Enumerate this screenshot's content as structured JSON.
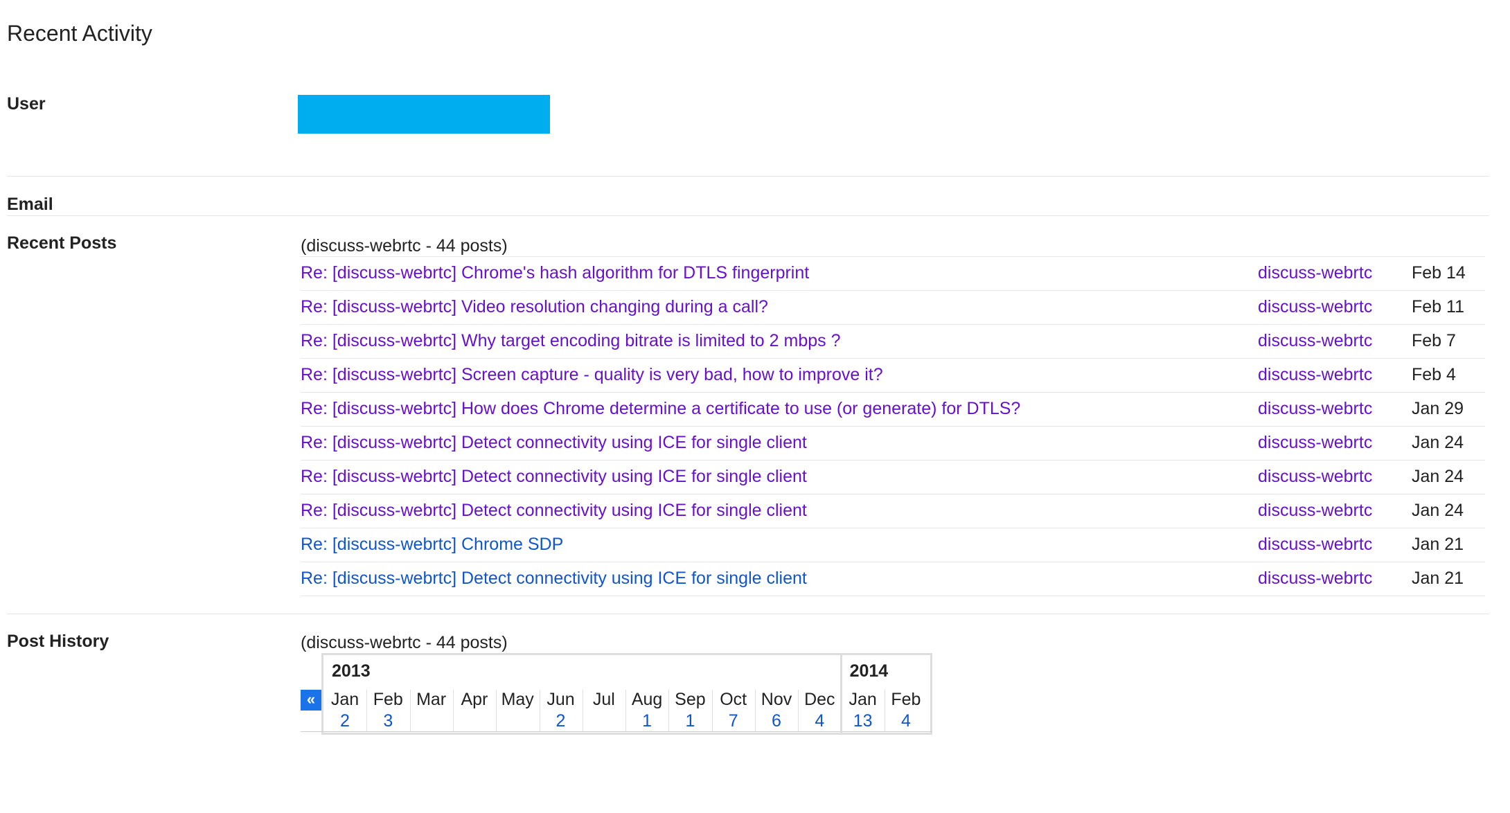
{
  "page": {
    "title": "Recent Activity"
  },
  "labels": {
    "user": "User",
    "email": "Email",
    "recent_posts": "Recent Posts",
    "post_history": "Post History"
  },
  "user_block_color": "#00aeef",
  "recent_posts": {
    "summary": "(discuss-webrtc - 44 posts)",
    "rows": [
      {
        "title": "Re: [discuss-webrtc] Chrome's hash algorithm for DTLS fingerprint",
        "group": "discuss-webrtc",
        "date": "Feb 14"
      },
      {
        "title": "Re: [discuss-webrtc] Video resolution changing during a call?",
        "group": "discuss-webrtc",
        "date": "Feb 11"
      },
      {
        "title": "Re: [discuss-webrtc] Why target encoding bitrate is limited to 2 mbps ?",
        "group": "discuss-webrtc",
        "date": "Feb 7"
      },
      {
        "title": "Re: [discuss-webrtc] Screen capture - quality is very bad, how to improve it?",
        "group": "discuss-webrtc",
        "date": "Feb 4"
      },
      {
        "title": "Re: [discuss-webrtc] How does Chrome determine a certificate to use (or generate) for DTLS?",
        "group": "discuss-webrtc",
        "date": "Jan 29"
      },
      {
        "title": "Re: [discuss-webrtc] Detect connectivity using ICE for single client",
        "group": "discuss-webrtc",
        "date": "Jan 24"
      },
      {
        "title": "Re: [discuss-webrtc] Detect connectivity using ICE for single client",
        "group": "discuss-webrtc",
        "date": "Jan 24"
      },
      {
        "title": "Re: [discuss-webrtc] Detect connectivity using ICE for single client",
        "group": "discuss-webrtc",
        "date": "Jan 24"
      },
      {
        "title": "Re: [discuss-webrtc] Chrome SDP",
        "group": "discuss-webrtc",
        "date": "Jan 21"
      },
      {
        "title": "Re: [discuss-webrtc] Detect connectivity using ICE for single client",
        "group": "discuss-webrtc",
        "date": "Jan 21"
      }
    ]
  },
  "post_history": {
    "summary": "(discuss-webrtc - 44 posts)",
    "prev_icon": "double-chevron-left-icon",
    "prev_glyph": "«",
    "years": [
      "2013",
      "2014"
    ],
    "months": [
      {
        "year": "2013",
        "month": "Jan",
        "count": "2"
      },
      {
        "year": "2013",
        "month": "Feb",
        "count": "3"
      },
      {
        "year": "2013",
        "month": "Mar",
        "count": ""
      },
      {
        "year": "2013",
        "month": "Apr",
        "count": ""
      },
      {
        "year": "2013",
        "month": "May",
        "count": ""
      },
      {
        "year": "2013",
        "month": "Jun",
        "count": "2"
      },
      {
        "year": "2013",
        "month": "Jul",
        "count": ""
      },
      {
        "year": "2013",
        "month": "Aug",
        "count": "1"
      },
      {
        "year": "2013",
        "month": "Sep",
        "count": "1"
      },
      {
        "year": "2013",
        "month": "Oct",
        "count": "7"
      },
      {
        "year": "2013",
        "month": "Nov",
        "count": "6"
      },
      {
        "year": "2013",
        "month": "Dec",
        "count": "4"
      },
      {
        "year": "2014",
        "month": "Jan",
        "count": "13"
      },
      {
        "year": "2014",
        "month": "Feb",
        "count": "4"
      }
    ]
  }
}
